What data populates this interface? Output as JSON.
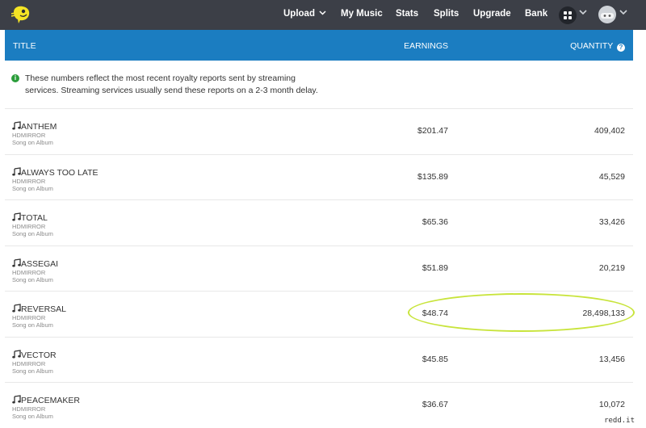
{
  "nav": {
    "items": [
      {
        "label": "Upload",
        "has_caret": true
      },
      {
        "label": "My Music"
      },
      {
        "label": "Stats"
      },
      {
        "label": "Splits"
      },
      {
        "label": "Upgrade"
      },
      {
        "label": "Bank"
      }
    ],
    "icons": [
      "apps-grid-icon",
      "user-avatar"
    ],
    "background": "#3c3f47",
    "logo_color": "#f4e425"
  },
  "table": {
    "headers": {
      "title": "TITLE",
      "earnings": "EARNINGS",
      "quantity": "QUANTITY"
    },
    "header_color": "#1b7dc1",
    "info": "These numbers reflect the most recent royalty reports sent by streaming services. Streaming services usually send these reports on a 2-3 month delay.",
    "rows": [
      {
        "title": "ANTHEM",
        "artist": "HDMIRROR",
        "type": "Song on Album",
        "earnings": "$201.47",
        "quantity": "409,402"
      },
      {
        "title": "ALWAYS TOO LATE",
        "artist": "HDMIRROR",
        "type": "Song on Album",
        "earnings": "$135.89",
        "quantity": "45,529"
      },
      {
        "title": "TOTAL",
        "artist": "HDMIRROR",
        "type": "Song on Album",
        "earnings": "$65.36",
        "quantity": "33,426"
      },
      {
        "title": "ASSEGAI",
        "artist": "HDMIRROR",
        "type": "Song on Album",
        "earnings": "$51.89",
        "quantity": "20,219"
      },
      {
        "title": "REVERSAL",
        "artist": "HDMIRROR",
        "type": "Song on Album",
        "earnings": "$48.74",
        "quantity": "28,498,133",
        "circled": true
      },
      {
        "title": "VECTOR",
        "artist": "HDMIRROR",
        "type": "Song on Album",
        "earnings": "$45.85",
        "quantity": "13,456"
      },
      {
        "title": "PEACEMAKER",
        "artist": "HDMIRROR",
        "type": "Song on Album",
        "earnings": "$36.67",
        "quantity": "10,072"
      }
    ]
  },
  "watermark": "redd.it"
}
